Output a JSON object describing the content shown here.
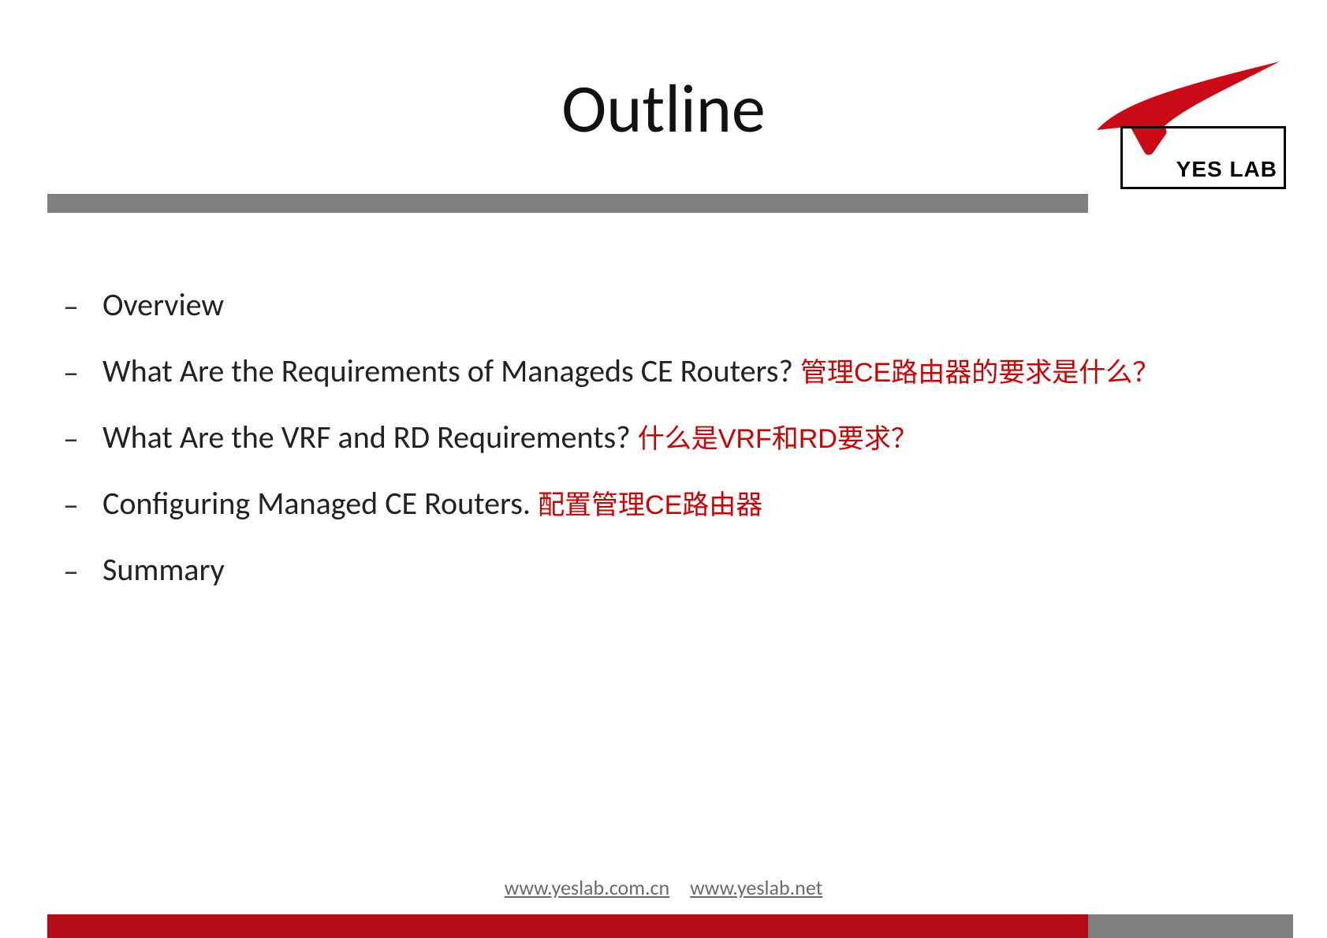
{
  "title": "Outline",
  "logo": {
    "text": "YES LAB"
  },
  "bullets": [
    {
      "en": "Overview",
      "zh": ""
    },
    {
      "en": "What Are the Requirements of Manageds CE Routers? ",
      "zh": "管理CE路由器的要求是什么？"
    },
    {
      "en": "What Are the VRF and RD Requirements? ",
      "zh": "什么是VRF和RD要求？"
    },
    {
      "en": "Configuring Managed CE Routers. ",
      "zh": "配置管理CE路由器"
    },
    {
      "en": "Summary",
      "zh": ""
    }
  ],
  "footer": {
    "link1": "www.yeslab.com.cn",
    "link2": "www.yeslab.net"
  }
}
